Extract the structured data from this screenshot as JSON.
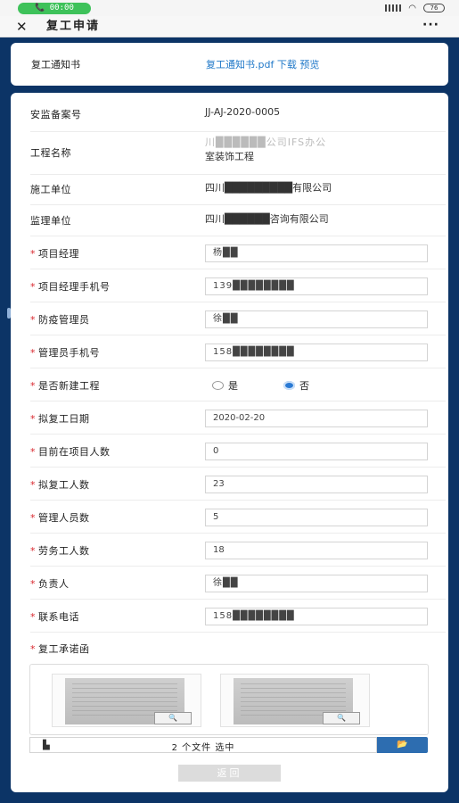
{
  "status": {
    "call_time": "00:00",
    "battery": "76"
  },
  "header": {
    "title": "复工申请",
    "close_icon": "close-icon",
    "more": "···"
  },
  "notice": {
    "label": "复工通知书",
    "link": "复工通知书.pdf 下载 预览"
  },
  "fields": {
    "filing_no": {
      "label": "安监备案号",
      "value": "JJ-AJ-2020-0005"
    },
    "project_name": {
      "label": "工程名称",
      "value_line1": "川██████公司IFS办公",
      "value_line2": "室装饰工程"
    },
    "construction_unit": {
      "label": "施工单位",
      "value": "四川█████████有限公司"
    },
    "supervision_unit": {
      "label": "监理单位",
      "value": "四川██████咨询有限公司"
    },
    "project_manager": {
      "label": "项目经理",
      "value": "杨██"
    },
    "pm_phone": {
      "label": "项目经理手机号",
      "value": "139████████"
    },
    "epidemic_manager": {
      "label": "防疫管理员",
      "value": "徐██"
    },
    "manager_phone": {
      "label": "管理员手机号",
      "value": "158████████"
    },
    "new_project": {
      "label": "是否新建工程",
      "yes": "是",
      "no": "否",
      "selected": "否"
    },
    "resume_date": {
      "label": "拟复工日期",
      "value": "2020-02-20"
    },
    "current_people": {
      "label": "目前在项目人数",
      "value": "0"
    },
    "resume_people": {
      "label": "拟复工人数",
      "value": "23"
    },
    "mgmt_people": {
      "label": "管理人员数",
      "value": "5"
    },
    "labor_people": {
      "label": "劳务工人数",
      "value": "18"
    },
    "person_in_charge": {
      "label": "负责人",
      "value": "徐██"
    },
    "contact_phone": {
      "label": "联系电话",
      "value": "158████████"
    },
    "commitment": {
      "label": "复工承诺函"
    }
  },
  "upload": {
    "file_status": "2 个文件 选中",
    "zoom_icon": "zoom-icon",
    "browse_icon": "folder-open-icon"
  },
  "actions": {
    "back": "返回"
  },
  "colors": {
    "accent": "#2d6db0",
    "link": "#1f78c8",
    "required": "#d9272e",
    "call": "#3ec25a",
    "backdrop": "#0c3466"
  }
}
